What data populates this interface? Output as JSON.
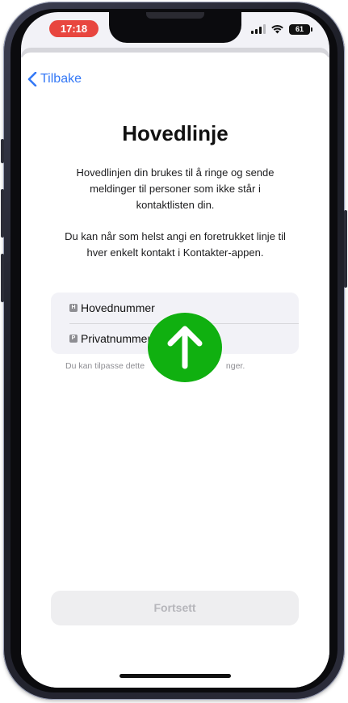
{
  "status_bar": {
    "time": "17:18",
    "battery": "61",
    "time_pill_color": "#e8463f",
    "icons": [
      "signal-icon",
      "wifi-icon",
      "battery-icon"
    ]
  },
  "nav": {
    "back_label": "Tilbake",
    "back_icon": "chevron-left-icon",
    "accent_color": "#3478f6"
  },
  "header": {
    "title": "Hovedlinje"
  },
  "body": {
    "description_lines": [
      "Hovedlinjen din brukes til å ringe og sende",
      "meldinger til personer som ikke står i",
      "kontaktlisten din."
    ],
    "info_lines": [
      "Du kan når som helst angi en foretrukket linje til",
      "hver enkelt kontakt i Kontakter-appen."
    ]
  },
  "line_options": [
    {
      "badge": "H",
      "label": "Hovednummer"
    },
    {
      "badge": "P",
      "label": "Privatnummer"
    }
  ],
  "footnote": "Du kan tilpasse dette",
  "footnote_tail": "nger.",
  "continue_button": {
    "label": "Fortsett",
    "state": "disabled"
  },
  "overlay": {
    "icon": "arrow-up-icon",
    "color": "#10b010"
  }
}
